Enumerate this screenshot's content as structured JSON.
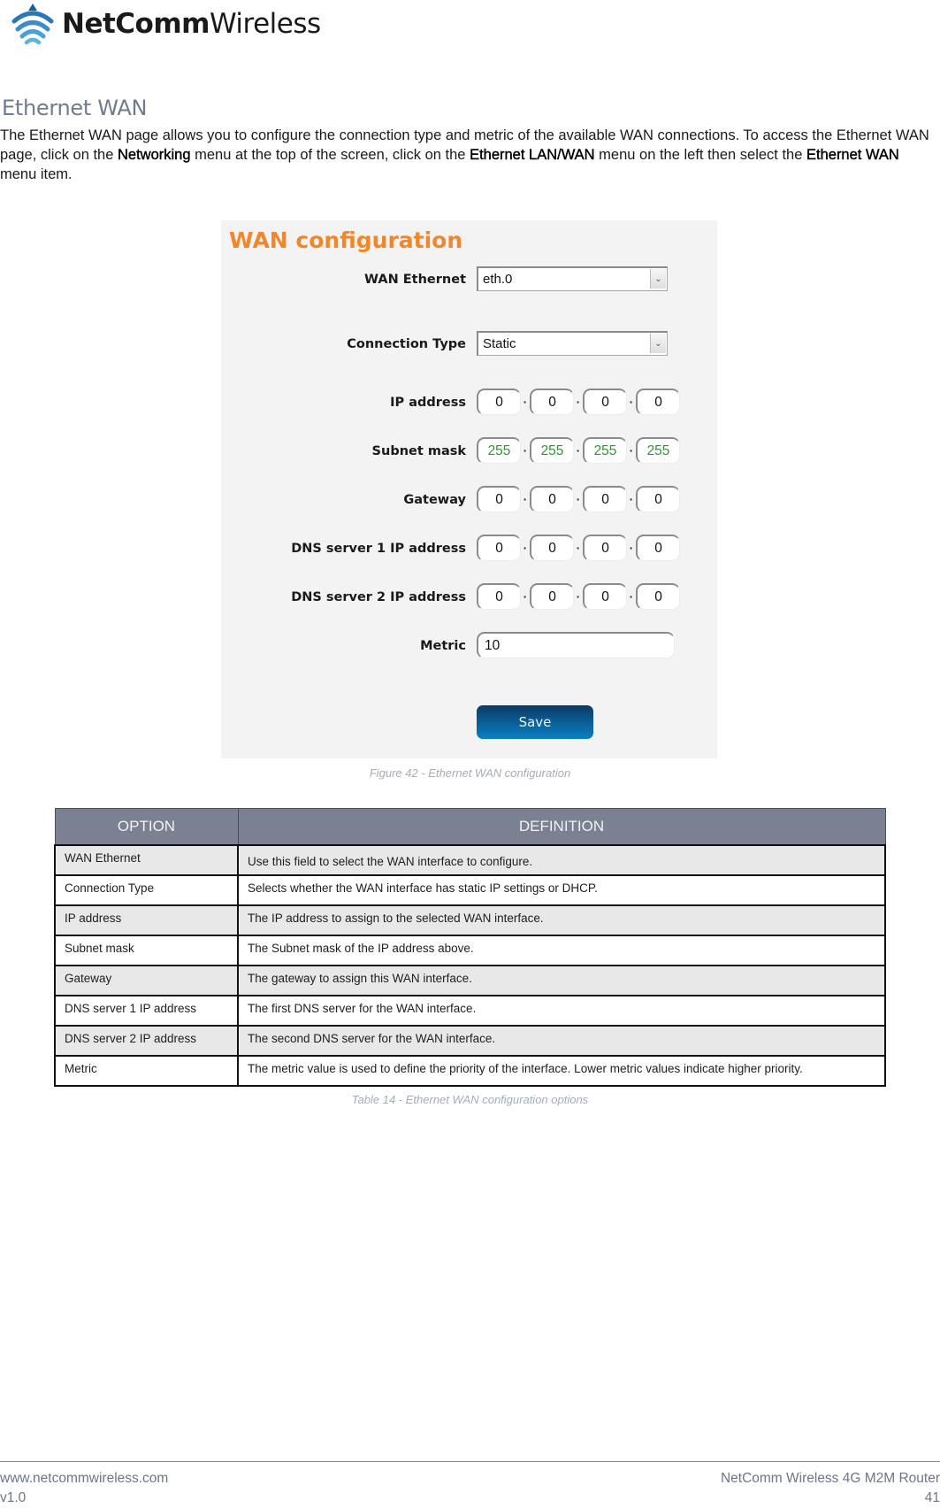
{
  "header": {
    "logo_bold": "NetComm",
    "logo_light": "Wireless"
  },
  "section": {
    "title": "Ethernet WAN",
    "intro_part1": "The Ethernet WAN page allows you to configure the connection type and metric of the available WAN connections. To access the Ethernet WAN page, click on the ",
    "link_networking": "Networking",
    "intro_part2": " menu at the top of the screen, click on the ",
    "link_lan_wan": "Ethernet LAN/WAN",
    "intro_part3": " menu on the left then select the ",
    "link_ethernet_wan": "Ethernet WAN",
    "intro_part4": " menu item."
  },
  "figure": {
    "title": "WAN configuration",
    "title_color": "#f0872a",
    "wan_ethernet": {
      "label": "WAN Ethernet",
      "value": "eth.0"
    },
    "connection_type": {
      "label": "Connection Type",
      "value": "Static"
    },
    "ip_address": {
      "label": "IP address",
      "octets": [
        "0",
        "0",
        "0",
        "0"
      ]
    },
    "subnet_mask": {
      "label": "Subnet mask",
      "octets": [
        "255",
        "255",
        "255",
        "255"
      ],
      "value_color": "#2a9a2a"
    },
    "gateway": {
      "label": "Gateway",
      "octets": [
        "0",
        "0",
        "0",
        "0"
      ]
    },
    "dns1": {
      "label": "DNS server 1 IP address",
      "octets": [
        "0",
        "0",
        "0",
        "0"
      ]
    },
    "dns2": {
      "label": "DNS server 2 IP address",
      "octets": [
        "0",
        "0",
        "0",
        "0"
      ]
    },
    "metric": {
      "label": "Metric",
      "value": "10"
    },
    "save_label": "Save",
    "caption": "Figure 42 - Ethernet WAN configuration"
  },
  "table": {
    "headers": [
      "OPTION",
      "DEFINITION"
    ],
    "header_color": "#7b8092",
    "rows": [
      {
        "option": "WAN Ethernet",
        "definition": "Use this field to select the WAN interface to configure."
      },
      {
        "option": "Connection Type",
        "definition": "Selects whether the WAN interface has static IP settings or DHCP."
      },
      {
        "option": "IP address",
        "definition": "The IP address to assign to the selected WAN interface."
      },
      {
        "option": "Subnet mask",
        "definition": "The Subnet mask of the IP address above."
      },
      {
        "option": "Gateway",
        "definition": "The gateway to assign this WAN interface."
      },
      {
        "option": "DNS server 1 IP address",
        "definition": "The first DNS server for the WAN interface."
      },
      {
        "option": "DNS server 2 IP address",
        "definition": "The second DNS server for the WAN interface."
      },
      {
        "option": "Metric",
        "definition": "The metric value is used to define the priority of the interface. Lower metric values indicate higher priority."
      }
    ],
    "caption": "Table 14 - Ethernet WAN configuration options"
  },
  "footer": {
    "website": "www.netcommwireless.com",
    "version": "v1.0",
    "product": "NetComm Wireless 4G M2M Router",
    "page_number": "41"
  }
}
